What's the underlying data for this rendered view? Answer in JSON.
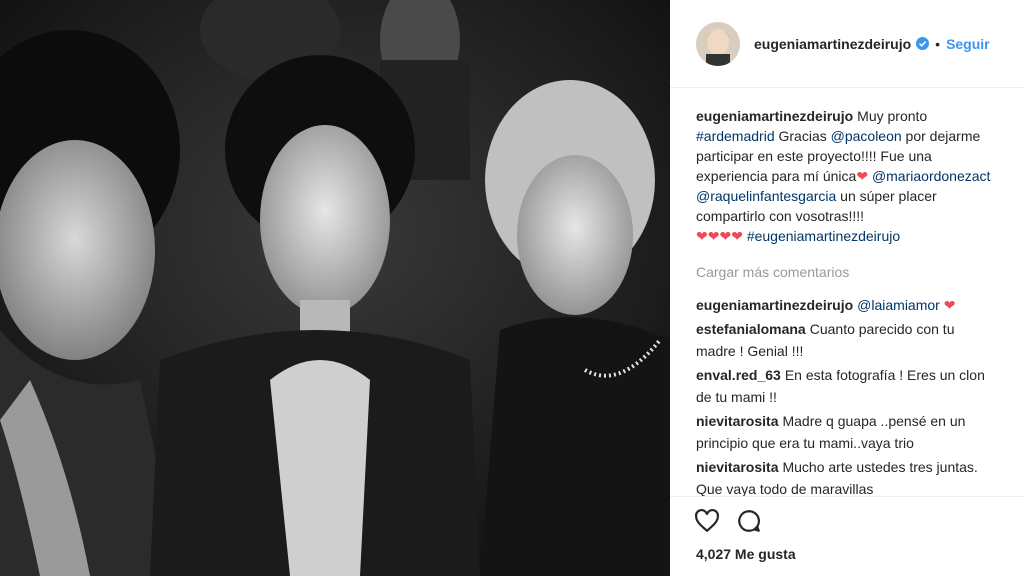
{
  "post": {
    "username": "eugeniamartinezdeirujo",
    "separator": "•",
    "follow_label": "Seguir"
  },
  "caption": {
    "username": "eugeniamartinezdeirujo",
    "parts": [
      "Muy pronto ",
      "#ardemadrid",
      " Gracias ",
      "@pacoleon",
      " por dejarme participar en este proyecto!!!! Fue una experiencia para mí única",
      "❤",
      " ",
      "@mariaordonezact",
      " ",
      "@raquelinfantesgarcia",
      " un súper placer compartirlo con vosotras!!!!",
      "❤❤❤❤",
      " ",
      "#eugeniamartinezdeirujo"
    ]
  },
  "load_more": "Cargar más comentarios",
  "comments": [
    {
      "user": "eugeniamartinezdeirujo",
      "text": "@laiamiamor",
      "suffix": "❤"
    },
    {
      "user": "estefanialomana",
      "text": "Cuanto parecido con tu madre ! Genial !!!",
      "suffix": ""
    },
    {
      "user": "enval.red_63",
      "text": "En esta fotografía ! Eres un clon de tu mami !!",
      "suffix": ""
    },
    {
      "user": "nievitarosita",
      "text": "Madre q guapa ..pensé en un principio que era tu mami..vaya trio",
      "suffix": ""
    },
    {
      "user": "nievitarosita",
      "text": "Mucho arte ustedes tres juntas. Que vaya todo de maravillas",
      "suffix": ""
    }
  ],
  "likes": "4,027 Me gusta",
  "icons": {
    "like": "heart-outline-icon",
    "comment": "comment-bubble-icon",
    "verified": "verified-badge-icon"
  },
  "colors": {
    "follow": "#3897f0",
    "heart": "#ed4956",
    "link": "#003569",
    "muted": "#999999"
  }
}
